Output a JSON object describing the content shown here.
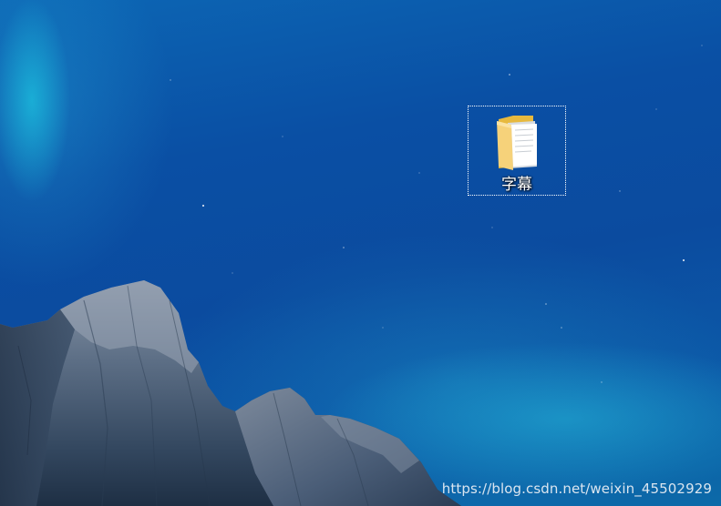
{
  "desktop": {
    "icons": [
      {
        "label": "字幕",
        "type": "folder-icon"
      }
    ]
  },
  "watermark": {
    "text": "https://blog.csdn.net/weixin_45502929"
  }
}
